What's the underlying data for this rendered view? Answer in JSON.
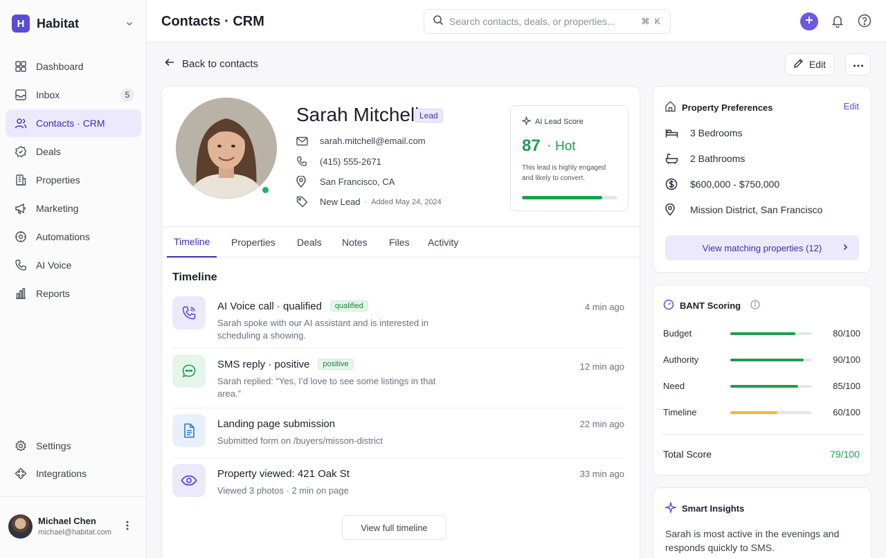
{
  "app": {
    "name": "Habitat",
    "logo_letter": "H"
  },
  "sidebar": {
    "items": [
      {
        "label": "Dashboard",
        "icon": "grid-icon"
      },
      {
        "label": "Inbox",
        "icon": "inbox-icon",
        "badge": "5"
      },
      {
        "label": "Contacts · CRM",
        "icon": "users-icon",
        "active": true
      },
      {
        "label": "Deals",
        "icon": "deals-icon"
      },
      {
        "label": "Properties",
        "icon": "building-icon"
      },
      {
        "label": "Marketing",
        "icon": "megaphone-icon"
      },
      {
        "label": "Automations",
        "icon": "automation-icon"
      },
      {
        "label": "AI Voice",
        "icon": "phone-icon"
      },
      {
        "label": "Reports",
        "icon": "bar-chart-icon"
      }
    ],
    "bottom": [
      {
        "label": "Settings",
        "icon": "gear-icon"
      },
      {
        "label": "Integrations",
        "icon": "puzzle-icon"
      }
    ],
    "user": {
      "name": "Michael Chen",
      "email": "michael@habitat.com"
    }
  },
  "header": {
    "title": "Contacts · CRM",
    "search_placeholder": "Search contacts, deals, or properties...",
    "search_shortcut": "⌘ K"
  },
  "toolbar": {
    "back_label": "Back to contacts",
    "edit_label": "Edit"
  },
  "contact": {
    "name": "Sarah Mitchell",
    "badge": "Lead",
    "email": "sarah.mitchell@email.com",
    "phone": "(415) 555-2671",
    "location": "San Francisco, CA",
    "status": "New Lead",
    "separator": "·",
    "added": "Added May 24, 2024"
  },
  "ai_score": {
    "title": "AI Lead Score",
    "score": "87",
    "dot": "·",
    "label": "Hot",
    "description": "This lead is highly engaged and likely to convert.",
    "bar_fraction": 0.84
  },
  "tabs": [
    "Timeline",
    "Properties",
    "Deals",
    "Notes",
    "Files",
    "Activity"
  ],
  "timeline": {
    "heading": "Timeline",
    "items": [
      {
        "title": "AI Voice call · qualified",
        "tag": "qualified",
        "desc": "Sarah spoke with our AI assistant and is interested in scheduling a showing.",
        "time": "4 min ago",
        "icon": "phone-icon"
      },
      {
        "title": "SMS reply · positive",
        "tag": "positive",
        "desc": "Sarah replied: “Yes, I’d love to see some listings in that area.”",
        "time": "12 min ago",
        "icon": "chat-icon"
      },
      {
        "title": "Landing page submission",
        "tag": "",
        "desc": "Submitted form on /buyers/misson-district",
        "time": "22 min ago",
        "icon": "document-icon"
      },
      {
        "title": "Property viewed: 421 Oak St",
        "tag": "",
        "desc": "Viewed 3 photos · 2 min on page",
        "time": "33 min ago",
        "icon": "eye-icon"
      }
    ],
    "view_full": "View full timeline"
  },
  "preferences": {
    "title": "Property Preferences",
    "edit": "Edit",
    "bedrooms": "3 Bedrooms",
    "bathrooms": "2 Bathrooms",
    "price": "$600,000 - $750,000",
    "area": "Mission District, San Francisco",
    "match_button": "View matching properties (12)"
  },
  "bant": {
    "title": "BANT Scoring",
    "rows": [
      {
        "label": "Budget",
        "value": "80/100",
        "fraction": 0.8,
        "color": "#1f9d4c"
      },
      {
        "label": "Authority",
        "value": "90/100",
        "fraction": 0.9,
        "color": "#1f9d4c"
      },
      {
        "label": "Need",
        "value": "85/100",
        "fraction": 0.83,
        "color": "#1f9d4c"
      },
      {
        "label": "Timeline",
        "value": "60/100",
        "fraction": 0.58,
        "color": "#f2b534"
      }
    ],
    "total_label": "Total Score",
    "total_value": "79/100"
  },
  "insights": {
    "title": "Smart Insights",
    "text": "Sarah is most active in the evenings and responds quickly to SMS."
  },
  "colors": {
    "accent": "#5b4bd6",
    "success": "#1f9d4c",
    "warning": "#f2b534"
  }
}
